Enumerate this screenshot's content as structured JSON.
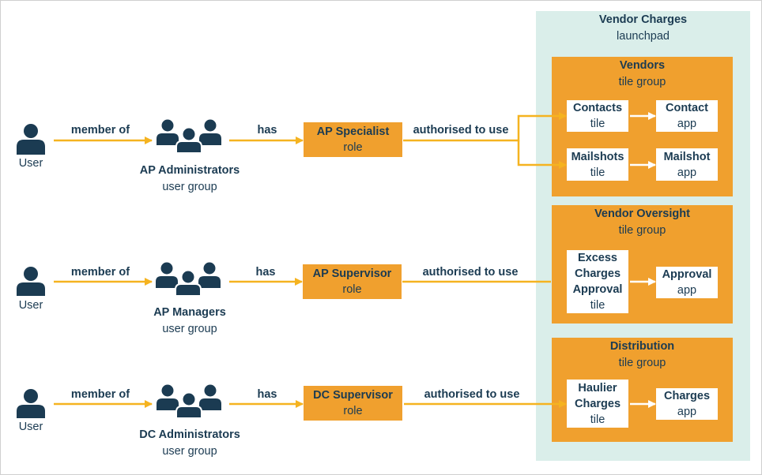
{
  "colors": {
    "navy": "#1b3b52",
    "orange": "#f0a02e",
    "arrow": "#f5b320",
    "launchpad_bg": "#daeeea"
  },
  "launchpad": {
    "title": "Vendor Charges",
    "subtitle": "launchpad"
  },
  "tile_groups": [
    {
      "title": "Vendors",
      "subtitle": "tile group",
      "items": [
        {
          "tile": "Contacts",
          "tile_sub": "tile",
          "app": "Contact",
          "app_sub": "app"
        },
        {
          "tile": "Mailshots",
          "tile_sub": "tile",
          "app": "Mailshot",
          "app_sub": "app"
        }
      ]
    },
    {
      "title": "Vendor Oversight",
      "subtitle": "tile group",
      "items": [
        {
          "tile_lines": [
            "Excess",
            "Charges",
            "Approval"
          ],
          "tile_sub": "tile",
          "app": "Approval",
          "app_sub": "app"
        }
      ]
    },
    {
      "title": "Distribution",
      "subtitle": "tile group",
      "items": [
        {
          "tile_lines": [
            "Haulier",
            "Charges"
          ],
          "tile_sub": "tile",
          "app": "Charges",
          "app_sub": "app"
        }
      ]
    }
  ],
  "rows": [
    {
      "user": "User",
      "member_label": "member of",
      "group": "AP Administrators",
      "group_sub": "user group",
      "has_label": "has",
      "role": "AP Specialist",
      "role_sub": "role",
      "auth_label": "authorised to use"
    },
    {
      "user": "User",
      "member_label": "member of",
      "group": "AP Managers",
      "group_sub": "user group",
      "has_label": "has",
      "role": "AP Supervisor",
      "role_sub": "role",
      "auth_label": "authorised to use"
    },
    {
      "user": "User",
      "member_label": "member of",
      "group": "DC Administrators",
      "group_sub": "user group",
      "has_label": "has",
      "role": "DC Supervisor",
      "role_sub": "role",
      "auth_label": "authorised to use"
    }
  ]
}
